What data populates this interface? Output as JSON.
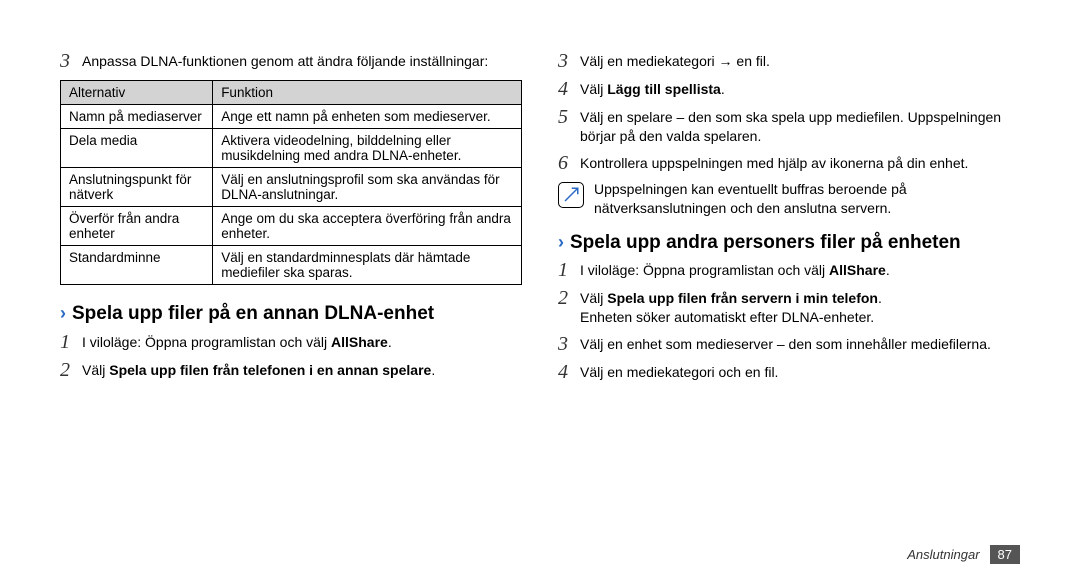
{
  "left": {
    "step3_num": "3",
    "step3_text": "Anpassa DLNA-funktionen genom att ändra följande inställningar:",
    "table": {
      "h1": "Alternativ",
      "h2": "Funktion",
      "rows": [
        {
          "a": "Namn på mediaserver",
          "b": "Ange ett namn på enheten som medieserver."
        },
        {
          "a": "Dela media",
          "b": "Aktivera videodelning, bilddelning eller musikdelning med andra DLNA-enheter."
        },
        {
          "a": "Anslutningspunkt för nätverk",
          "b": "Välj en anslutningsprofil som ska användas för DLNA-anslutningar."
        },
        {
          "a": "Överför från andra enheter",
          "b": "Ange om du ska acceptera överföring från andra enheter."
        },
        {
          "a": "Standardminne",
          "b": "Välj en standardminnesplats där hämtade mediefiler ska sparas."
        }
      ]
    },
    "section1_title": "Spela upp filer på en annan DLNA-enhet",
    "s1_step1_num": "1",
    "s1_step1_a": "I viloläge: Öppna programlistan och välj ",
    "s1_step1_b": "AllShare",
    "s1_step1_c": ".",
    "s1_step2_num": "2",
    "s1_step2_a": "Välj ",
    "s1_step2_b": "Spela upp filen från telefonen i en annan spelare",
    "s1_step2_c": "."
  },
  "right": {
    "s3_num": "3",
    "s3_a": "Välj en mediekategori ",
    "s3_arrow": "→",
    "s3_b": " en fil.",
    "s4_num": "4",
    "s4_a": "Välj ",
    "s4_b": "Lägg till spellista",
    "s4_c": ".",
    "s5_num": "5",
    "s5_text": "Välj en spelare – den som ska spela upp mediefilen. Uppspelningen börjar på den valda spelaren.",
    "s6_num": "6",
    "s6_text": "Kontrollera uppspelningen med hjälp av ikonerna på din enhet.",
    "note_text": "Uppspelningen kan eventuellt buffras beroende på nätverksanslutningen och den anslutna servern.",
    "section2_title": "Spela upp andra personers filer på enheten",
    "b1_num": "1",
    "b1_a": "I viloläge: Öppna programlistan och välj ",
    "b1_b": "AllShare",
    "b1_c": ".",
    "b2_num": "2",
    "b2_a": "Välj ",
    "b2_b": "Spela upp filen från servern i min telefon",
    "b2_c": ".",
    "b2_extra": "Enheten söker automatiskt efter DLNA-enheter.",
    "b3_num": "3",
    "b3_text": "Välj en enhet som medieserver – den som innehåller mediefilerna.",
    "b4_num": "4",
    "b4_text": "Välj en mediekategori och en fil."
  },
  "footer": {
    "label": "Anslutningar",
    "page": "87"
  }
}
